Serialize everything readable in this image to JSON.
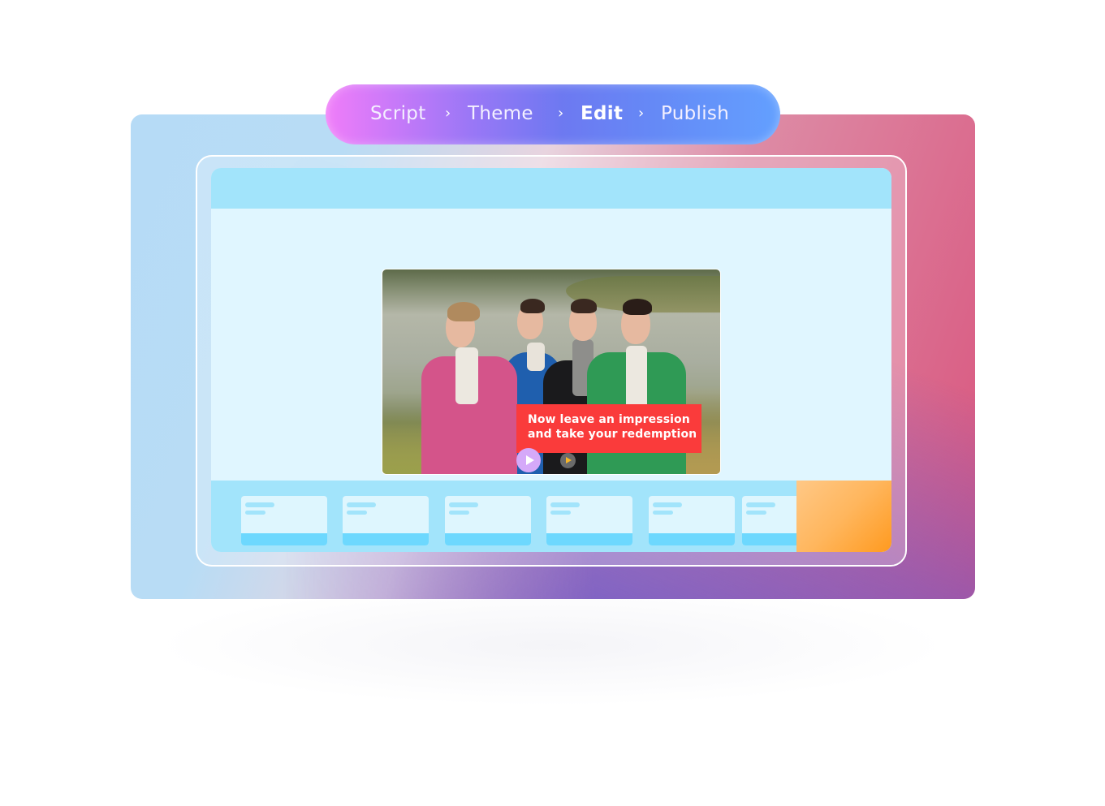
{
  "stepper": {
    "steps": [
      {
        "label": "Script",
        "active": false
      },
      {
        "label": "Theme",
        "active": false
      },
      {
        "label": "Edit",
        "active": true
      },
      {
        "label": "Publish",
        "active": false
      }
    ],
    "separator_icon": "chevron-right-icon",
    "separator_glyph": "›"
  },
  "editor": {
    "video": {
      "caption_line1": "Now leave an impression",
      "caption_line2": "and take your redemption",
      "caption_bg": "#fa3b3b"
    },
    "controls": {
      "play_main_icon": "play-icon",
      "play_small_icon": "play-icon"
    },
    "timeline": {
      "thumbnails": [
        {
          "name": "scene-1"
        },
        {
          "name": "scene-2"
        },
        {
          "name": "scene-3"
        },
        {
          "name": "scene-4"
        },
        {
          "name": "scene-5"
        },
        {
          "name": "scene-6"
        }
      ]
    }
  },
  "colors": {
    "accent_purple": "#d5a9f9",
    "accent_orange": "#ff9a1f",
    "panel_blue": "#a2e4fb",
    "stage_blue": "#e0f6ff"
  }
}
